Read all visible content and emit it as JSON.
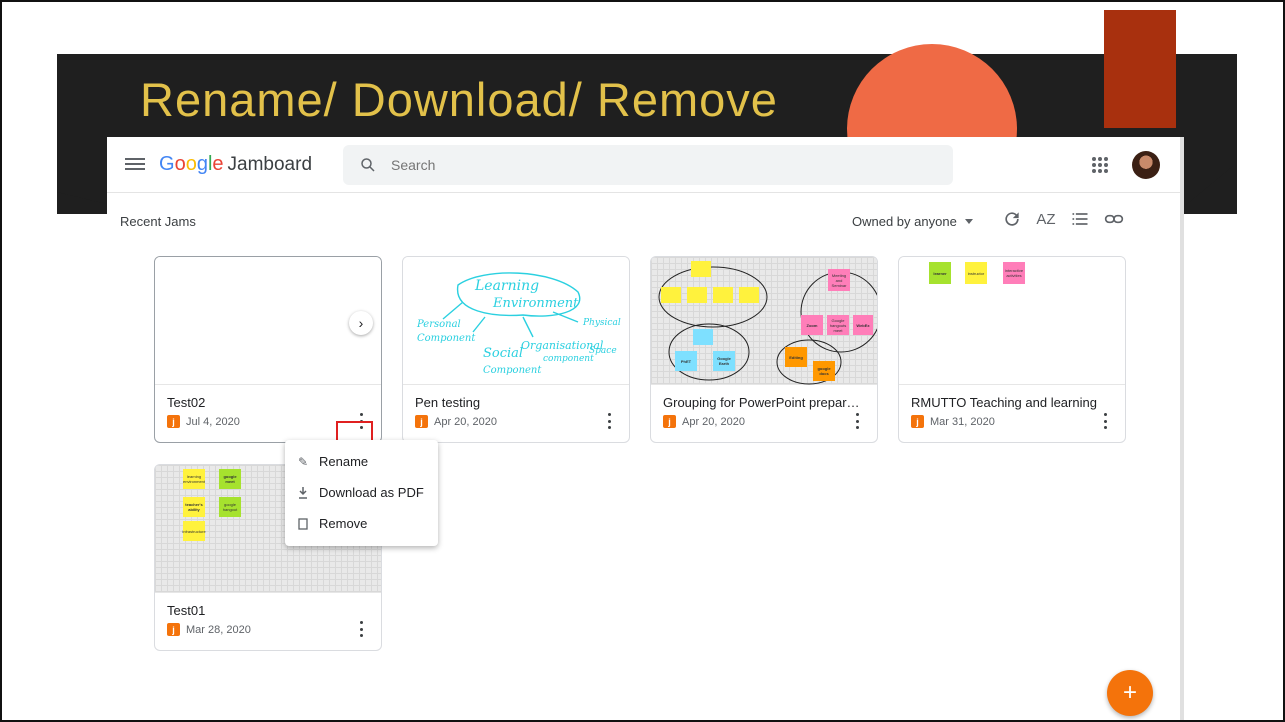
{
  "slide": {
    "title": "Rename/ Download/ Remove"
  },
  "app": {
    "logo": {
      "google": "Google",
      "product": "Jamboard"
    },
    "search_placeholder": "Search",
    "section_title": "Recent Jams",
    "owner_filter": "Owned by anyone",
    "sort_label": "AZ"
  },
  "cards": [
    {
      "title": "Test02",
      "date": "Jul 4, 2020"
    },
    {
      "title": "Pen testing",
      "date": "Apr 20, 2020"
    },
    {
      "title": "Grouping for PowerPoint prepara...",
      "date": "Apr 20, 2020"
    },
    {
      "title": "RMUTTO Teaching and learning",
      "date": "Mar 31, 2020"
    },
    {
      "title": "Test01",
      "date": "Mar 28, 2020"
    }
  ],
  "thumbs": {
    "pen": {
      "l1": "Learning",
      "l2": "Environment",
      "a": "Personal",
      "b": "Component",
      "c": "Social",
      "d": "Component",
      "e": "Organisational",
      "f": "component",
      "g": "Physical",
      "h": "Space"
    },
    "grouping": [
      "PhET",
      "Google Earth",
      "Zoom",
      "Google hangouts meet",
      "WebEx",
      "Editing",
      "google docs",
      "Meeting and Seminar"
    ],
    "rmutto": [
      "learner",
      "instructor",
      "interactive activities"
    ],
    "test01": [
      "learning environment",
      "google meet",
      "teacher's ability",
      "google hangout",
      "infrastructure"
    ]
  },
  "menu": {
    "rename": "Rename",
    "download": "Download as PDF",
    "remove": "Remove"
  },
  "fab_label": "+",
  "colors": {
    "accent": "#f4730b",
    "title": "#e2c14a",
    "highlight": "#e02020"
  }
}
